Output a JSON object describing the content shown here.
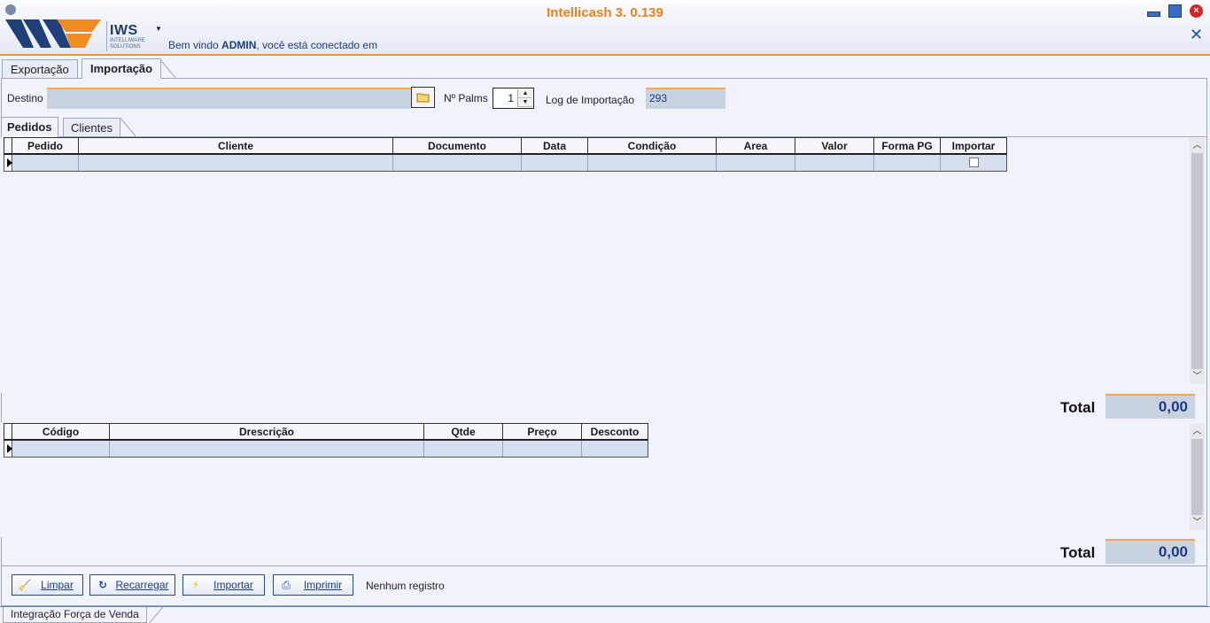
{
  "header": {
    "app_title": "Intellicash 3. 0.139",
    "logo_name": "IWS",
    "logo_sub": "INTELLIWARE SOLUTIONS",
    "welcome_prefix": "Bem vindo ",
    "welcome_user": "ADMIN",
    "welcome_suffix": ", você está conectado em"
  },
  "top_tabs": [
    {
      "label": "Exportação",
      "active": false
    },
    {
      "label": "Importação",
      "active": true
    }
  ],
  "form": {
    "destino_label": "Destino",
    "destino_value": "",
    "palms_label": "Nº Palms",
    "palms_value": "1",
    "log_label": "Log de Importação",
    "log_value": "293"
  },
  "sub_tabs": [
    {
      "label": "Pedidos",
      "active": true
    },
    {
      "label": "Clientes",
      "active": false
    }
  ],
  "orders_grid": {
    "columns": [
      "Pedido",
      "Cliente",
      "Documento",
      "Data",
      "Condição",
      "Area",
      "Valor",
      "Forma PG",
      "Importar"
    ],
    "rows": [
      {
        "importar": false
      }
    ]
  },
  "orders_total": {
    "label": "Total",
    "value": "0,00"
  },
  "items_grid": {
    "columns": [
      "Código",
      "Drescrição",
      "Qtde",
      "Preço",
      "Desconto"
    ],
    "rows": [
      {}
    ]
  },
  "items_total": {
    "label": "Total",
    "value": "0,00"
  },
  "buttons": {
    "limpar": "Limpar",
    "recarregar": "Recarregar",
    "importar": "Importar",
    "imprimir": "Imprimir"
  },
  "status": "Nenhum registro",
  "bottom_tab": "Integração Força de Venda"
}
